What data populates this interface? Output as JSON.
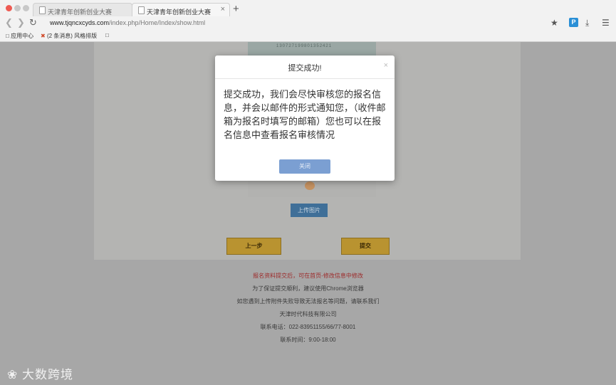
{
  "browser": {
    "tabs": [
      {
        "title": "天津青年创新创业大赛"
      },
      {
        "title": "天津青年创新创业大赛"
      }
    ],
    "new_tab_glyph": "+",
    "close_glyph": "×",
    "url_host": "www.tjqncxcyds.com",
    "url_path": "/index.php/Home/Index/show.html",
    "bookmarks": [
      {
        "label": "应用中心"
      },
      {
        "label": "(2 条消息) 风格排版"
      }
    ],
    "icons": [
      "back-icon",
      "forward-icon",
      "reload-icon",
      "star-icon",
      "extension-p-icon",
      "download-icon",
      "menu-icon"
    ],
    "extension_badge": "P"
  },
  "page": {
    "id_strip_text": "130727199801352421",
    "upload_button": "上传图片",
    "prev_button": "上一步",
    "submit_button": "提交",
    "footer_lines": [
      {
        "text": "报名资料提交后，可在首页-修改信息中修改",
        "color": "#9d2a2a"
      },
      {
        "text": "为了保证提交顺利，建议使用Chrome浏览器"
      },
      {
        "text": "如您遇到上传附件失败导致无法报名等问题，请联系我们"
      },
      {
        "text": "天津时代科技有限公司"
      },
      {
        "text": "联系电话：022-83951155/66/77-8001"
      },
      {
        "text": "联系时间：9:00-18:00"
      }
    ],
    "watermark": "大数跨境"
  },
  "modal": {
    "title": "提交成功!",
    "close_glyph": "×",
    "message": "提交成功，我们会尽快审核您的报名信息，并会以邮件的形式通知您，（收件邮箱为报名时填写的邮箱）您也可以在报名信息中查看报名审核情况",
    "ok_button": "关闭"
  },
  "colors": {
    "overlay_page": "#a7a7a7",
    "modal_button": "#7b9fd2",
    "submit_gold": "#b99330",
    "upload_blue": "#3f6f98"
  }
}
